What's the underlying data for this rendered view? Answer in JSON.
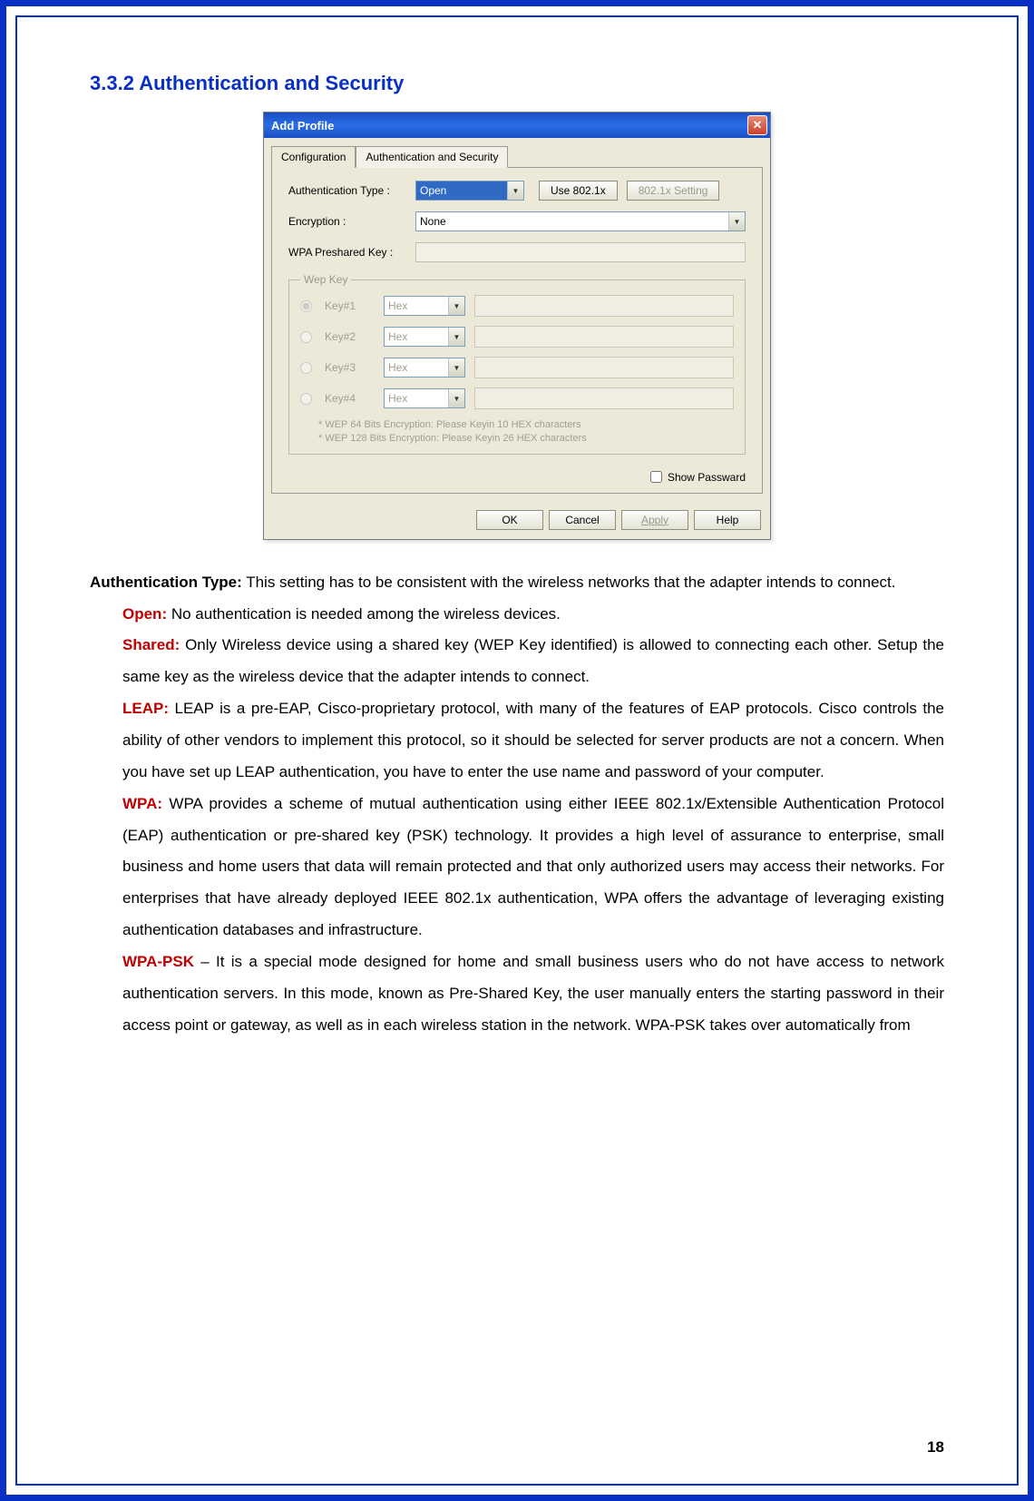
{
  "heading": "3.3.2 Authentication and Security",
  "dialog": {
    "title": "Add Profile",
    "tabs": {
      "config": "Configuration",
      "auth": "Authentication and Security"
    },
    "labels": {
      "auth_type": "Authentication Type :",
      "encryption": "Encryption :",
      "wpa_psk": "WPA Preshared Key :",
      "use8021x": "Use 802.1x",
      "setting8021x": "802.1x Setting",
      "wep_legend": "Wep Key",
      "show_pw": "Show Passward"
    },
    "values": {
      "auth_type": "Open",
      "encryption": "None",
      "hex": "Hex"
    },
    "keys": [
      "Key#1",
      "Key#2",
      "Key#3",
      "Key#4"
    ],
    "notes": {
      "n1": "* WEP 64 Bits Encryption:   Please Keyin 10 HEX characters",
      "n2": "* WEP 128 Bits Encryption:   Please Keyin 26 HEX characters"
    },
    "buttons": {
      "ok": "OK",
      "cancel": "Cancel",
      "apply": "Apply",
      "help": "Help"
    }
  },
  "doc": {
    "p_auth_type_label": "Authentication Type:",
    "p_auth_type_text": " This setting has to be consistent with the wireless networks that the adapter intends to connect.",
    "open_label": "Open:",
    "open_text": " No authentication is needed among the wireless devices.",
    "shared_label": "Shared:",
    "shared_text": " Only Wireless device using a shared key (WEP Key identified) is allowed to connecting each other. Setup the same key as the wireless device that the adapter intends to connect.",
    "leap_label": "LEAP:",
    "leap_text": " LEAP is a pre-EAP, Cisco-proprietary protocol, with many of the features of EAP protocols. Cisco controls the ability of other vendors to implement this protocol, so it should be selected for server products are not a concern. When you have set up LEAP authentication, you have to enter the use name and password of your computer.",
    "wpa_label": "WPA:",
    "wpa_text": " WPA provides a scheme of mutual authentication using either IEEE 802.1x/Extensible Authentication Protocol (EAP) authentication or pre-shared key (PSK) technology. It provides a high level of assurance to enterprise, small business and home users that data will remain protected and that only authorized users may access their networks. For enterprises that have already deployed IEEE 802.1x authentication, WPA offers the advantage of leveraging existing authentication databases and infrastructure.",
    "wpapsk_label": "WPA-PSK",
    "wpapsk_text": " – It is a special mode designed for home and small business users who do not have access to network authentication servers. In this mode, known as Pre-Shared Key, the user manually enters the starting password in their access point or gateway, as well as in each wireless station in the network. WPA-PSK takes over automatically from"
  },
  "page_number": "18"
}
